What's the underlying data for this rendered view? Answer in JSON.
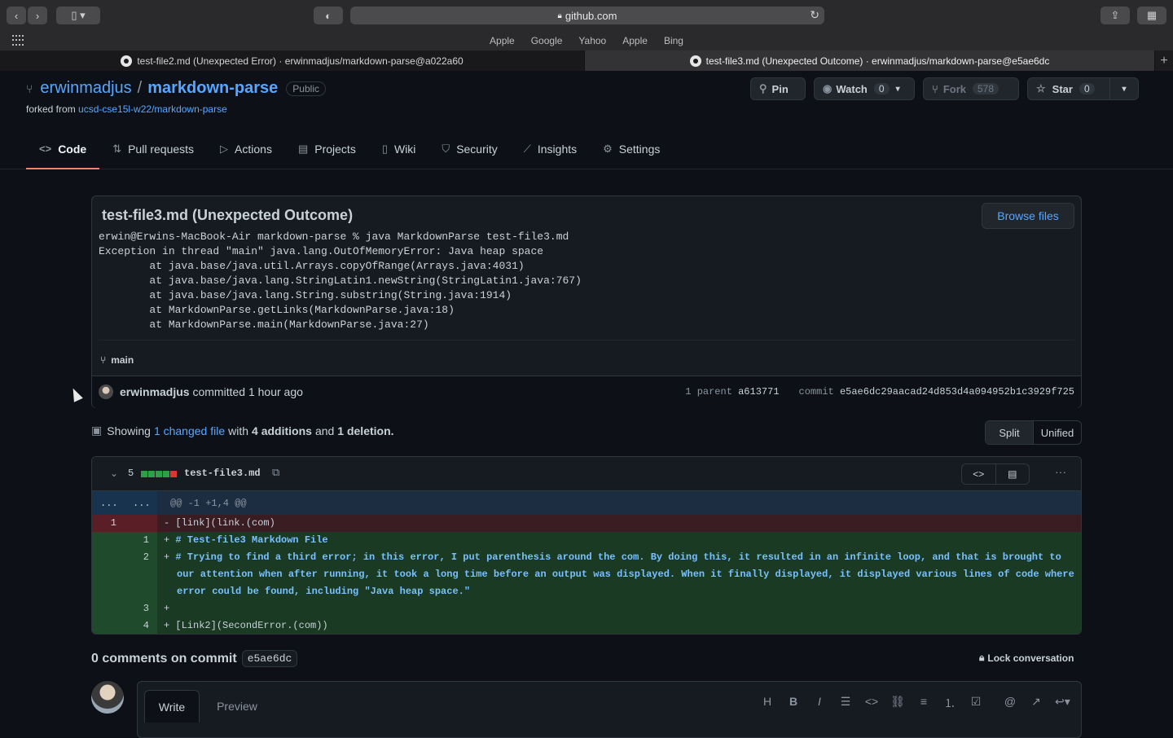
{
  "browser": {
    "url": "github.com",
    "favorites": [
      "Apple",
      "Google",
      "Yahoo",
      "Apple",
      "Bing"
    ],
    "tabs": [
      {
        "title": "test-file2.md (Unexpected Error) · erwinmadjus/markdown-parse@a022a60"
      },
      {
        "title": "test-file3.md (Unexpected Outcome) · erwinmadjus/markdown-parse@e5ae6dc"
      }
    ]
  },
  "repo": {
    "owner": "erwinmadjus",
    "name": "markdown-parse",
    "visibility": "Public",
    "forked_prefix": "forked from",
    "forked_from": "ucsd-cse15l-w22/markdown-parse",
    "pin_label": "Pin",
    "watch_label": "Watch",
    "watch_count": "0",
    "fork_label": "Fork",
    "fork_count": "578",
    "star_label": "Star",
    "star_count": "0"
  },
  "nav": {
    "items": [
      {
        "label": "Code",
        "icon": "code-icon"
      },
      {
        "label": "Pull requests",
        "icon": "pull-request-icon"
      },
      {
        "label": "Actions",
        "icon": "play-icon"
      },
      {
        "label": "Projects",
        "icon": "table-icon"
      },
      {
        "label": "Wiki",
        "icon": "book-icon"
      },
      {
        "label": "Security",
        "icon": "shield-icon"
      },
      {
        "label": "Insights",
        "icon": "graph-icon"
      },
      {
        "label": "Settings",
        "icon": "gear-icon"
      }
    ]
  },
  "commit": {
    "title": "test-file3.md (Unexpected Outcome)",
    "browse_label": "Browse files",
    "description": "erwin@Erwins-MacBook-Air markdown-parse % java MarkdownParse test-file3.md\nException in thread \"main\" java.lang.OutOfMemoryError: Java heap space\n        at java.base/java.util.Arrays.copyOfRange(Arrays.java:4031)\n        at java.base/java.lang.StringLatin1.newString(StringLatin1.java:767)\n        at java.base/java.lang.String.substring(String.java:1914)\n        at MarkdownParse.getLinks(MarkdownParse.java:18)\n        at MarkdownParse.main(MarkdownParse.java:27)",
    "branch": "main",
    "author": "erwinmadjus",
    "committed_text": "committed 1 hour ago",
    "parent_label": "1 parent",
    "parent_sha": "a613771",
    "commit_label": "commit",
    "sha": "e5ae6dc29aacad24d853d4a094952b1c3929f725"
  },
  "summary": {
    "showing": "Showing",
    "changed": "1 changed file",
    "with": "with",
    "additions": "4 additions",
    "and": "and",
    "deletions": "1 deletion."
  },
  "view_toggle": {
    "split": "Split",
    "unified": "Unified"
  },
  "diff": {
    "count": "5",
    "filename": "test-file3.md",
    "hunk_left": "...",
    "hunk_right": "...",
    "hunk_header": "@@ -1 +1,4 @@",
    "lines": [
      {
        "type": "del",
        "old": "1",
        "new": "",
        "sign": "-",
        "text": "[link](link.(com)"
      },
      {
        "type": "add",
        "old": "",
        "new": "1",
        "sign": "+",
        "text": "# Test-file3 Markdown File",
        "heading": true
      },
      {
        "type": "add",
        "old": "",
        "new": "2",
        "sign": "+",
        "text": "# Trying to find a third error; in this error, I put parenthesis around the com. By doing this, it resulted in an infinite loop, and that is brought to our attention when after running, it took a long time before an output was displayed. When it finally displayed, it displayed various lines of code where error could be found, including \"Java heap space.\"",
        "heading": true
      },
      {
        "type": "add",
        "old": "",
        "new": "3",
        "sign": "+",
        "text": ""
      },
      {
        "type": "add",
        "old": "",
        "new": "4",
        "sign": "+",
        "text": "[Link2](SecondError.(com))"
      }
    ]
  },
  "comments": {
    "title": "0 comments on commit",
    "sha": "e5ae6dc",
    "lock_label": "Lock conversation",
    "write_tab": "Write",
    "preview_tab": "Preview"
  },
  "colors": {
    "accent_link": "#58a6ff",
    "addition": "#2ea043",
    "deletion": "#da3633",
    "tab_underline": "#f78166"
  }
}
